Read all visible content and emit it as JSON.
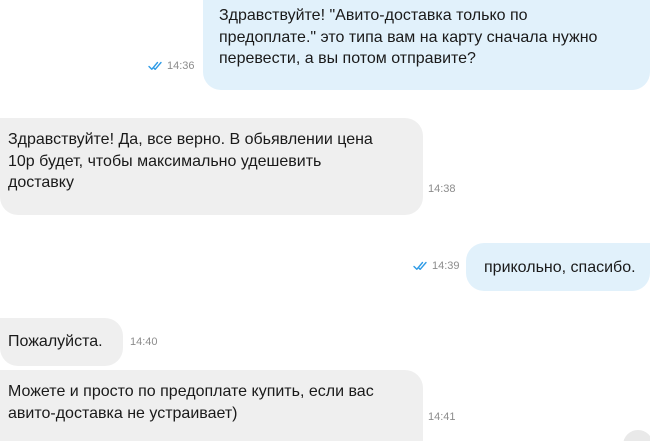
{
  "messages": [
    {
      "direction": "outgoing",
      "lines": [
        "Здравствуйте! \"Авито-доставка только по",
        "предоплате.\" это типа вам на карту сначала нужно",
        "перевести, а вы потом отправите?"
      ],
      "time": "14:36",
      "status_icon": "double-check-icon"
    },
    {
      "direction": "incoming",
      "lines": [
        "Здравствуйте! Да, все верно. В обьявлении цена",
        "10р будет, чтобы максимально удешевить",
        "доставку"
      ],
      "time": "14:38"
    },
    {
      "direction": "outgoing",
      "lines": [
        "прикольно, спасибо."
      ],
      "time": "14:39",
      "status_icon": "double-check-icon"
    },
    {
      "direction": "incoming",
      "lines": [
        "Пожалуйста."
      ],
      "time": "14:40"
    },
    {
      "direction": "incoming",
      "lines": [
        "Можете и просто по предоплате купить, если вас",
        "авито-доставка не устраивает)"
      ],
      "time": "14:41"
    }
  ],
  "colors": {
    "outgoing_bubble": "#e1f1fb",
    "incoming_bubble": "#efefef",
    "read_check": "#2e9be6",
    "timestamp": "#8c8c8c"
  }
}
